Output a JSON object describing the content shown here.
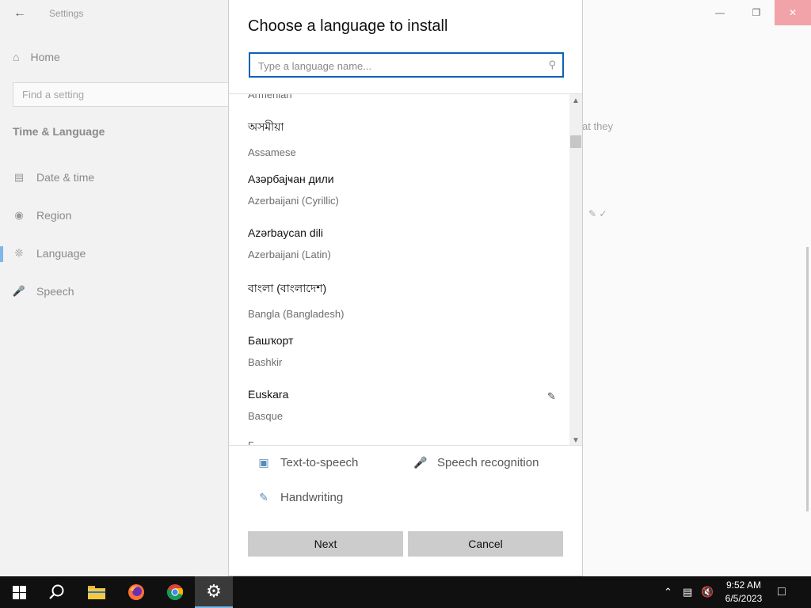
{
  "window": {
    "app_title": "Settings",
    "controls": [
      "minimize",
      "restore",
      "close"
    ]
  },
  "sidebar": {
    "home_label": "Home",
    "search_placeholder": "Find a setting",
    "section_title": "Time & Language",
    "items": [
      {
        "label": "Date & time",
        "icon": "calendar-clock-icon"
      },
      {
        "label": "Region",
        "icon": "globe-icon"
      },
      {
        "label": "Language",
        "icon": "language-icon",
        "active": true
      },
      {
        "label": "Speech",
        "icon": "microphone-icon"
      }
    ]
  },
  "background_fragment": "at they",
  "dialog": {
    "title": "Choose a language to install",
    "search_placeholder": "Type a language name...",
    "search_value": "",
    "partial_top": "Armenian",
    "languages": [
      {
        "native": "অসমীয়া",
        "english": "Assamese"
      },
      {
        "native": "Азәрбајҹан дили",
        "english": "Azerbaijani (Cyrillic)"
      },
      {
        "native": "Azərbaycan dili",
        "english": "Azerbaijani (Latin)"
      },
      {
        "native": "বাংলা (বাংলাদেশ)",
        "english": "Bangla (Bangladesh)"
      },
      {
        "native": "Башҡорт",
        "english": "Bashkir"
      },
      {
        "native": "Euskara",
        "english": "Basque",
        "handwriting": true
      }
    ],
    "partial_bottom": "Б",
    "features": {
      "tts": "Text-to-speech",
      "speech": "Speech recognition",
      "handwriting": "Handwriting"
    },
    "buttons": {
      "next": "Next",
      "cancel": "Cancel"
    }
  },
  "taskbar": {
    "items": [
      "start",
      "search",
      "file-explorer",
      "firefox",
      "chrome",
      "settings"
    ],
    "time": "9:52 AM",
    "date": "6/5/2023"
  }
}
